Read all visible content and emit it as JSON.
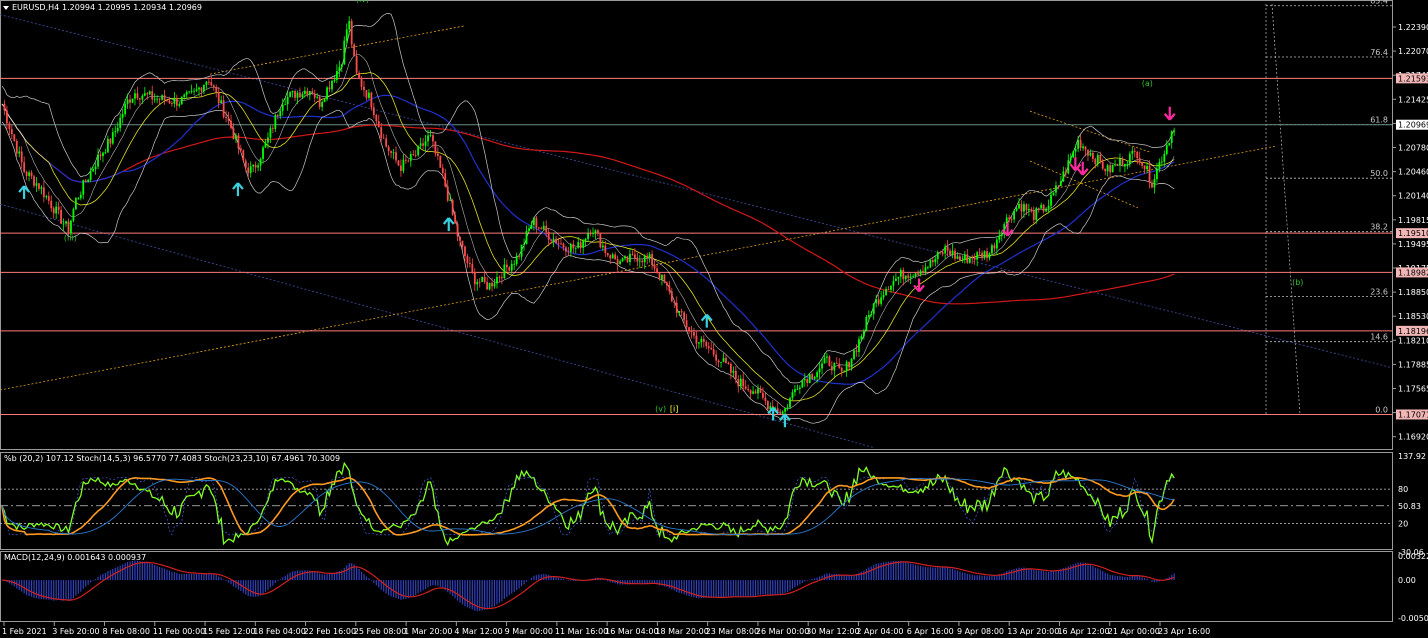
{
  "header": {
    "symbol": "EURUSD,H4",
    "ohlc": "1.20994 1.20995 1.20934 1.20969"
  },
  "colors": {
    "background": "#000000",
    "bull": "#00ff00",
    "bear": "#ff4d4d",
    "resistance": "#ff7b7b",
    "ma_red": "#d01818",
    "ma_blue": "#2030d0",
    "ma_yellow": "#e0e020",
    "bands": "#c8c8c8",
    "trend_orange": "#e0a020",
    "channel_blue": "#4050a0",
    "arrow_up": "#39d0e0",
    "arrow_down": "#ff2aa0",
    "wave_label": "#30c030",
    "stoch_green": "#80ff20",
    "stoch_orange": "#ff9a20",
    "macd_line": "#d02020",
    "macd_hist": "#3040c0",
    "price_box": "#f2b6b6"
  },
  "main_panel": {
    "price_scale": [
      "1.22390",
      "1.22070",
      "1.21745",
      "1.21425",
      "1.21105",
      "1.20780",
      "1.20460",
      "1.20140",
      "1.19815",
      "1.19495",
      "1.19175",
      "1.18850",
      "1.18530",
      "1.18210",
      "1.17885",
      "1.17565",
      "1.17245",
      "1.16920"
    ],
    "level_boxes": [
      {
        "label": "1.21593",
        "value": 1.21593
      },
      {
        "label": "1.20969",
        "value": 1.20969
      },
      {
        "label": "1.19510",
        "value": 1.1951
      },
      {
        "label": "1.18982",
        "value": 1.18982
      },
      {
        "label": "1.18196",
        "value": 1.18196
      },
      {
        "label": "1.17071",
        "value": 1.17071
      }
    ],
    "fib_levels": [
      {
        "label": "85.4",
        "value": 1.2257
      },
      {
        "label": "76.4",
        "value": 1.2188
      },
      {
        "label": "61.8",
        "value": 1.2097
      },
      {
        "label": "50.0",
        "value": 1.2025
      },
      {
        "label": "38.2",
        "value": 1.1953
      },
      {
        "label": "23.6",
        "value": 1.1866
      },
      {
        "label": "14.6",
        "value": 1.1805
      },
      {
        "label": "0.0",
        "value": 1.1707
      }
    ],
    "wave_labels": [
      {
        "text": "(iv)",
        "date": 24.0,
        "price": 1.2262
      },
      {
        "text": "(iii)",
        "date": 4.2,
        "price": 1.1941
      },
      {
        "text": "(v)",
        "date": 44.3,
        "price": 1.1711
      },
      {
        "text": "[i]",
        "date": 45.3,
        "price": 1.1711
      },
      {
        "text": "(a)",
        "date": 77.3,
        "price": 1.2149
      },
      {
        "text": "(b)",
        "date": 87.5,
        "price": 1.1881
      }
    ],
    "arrows_up": [
      {
        "date": 1.5,
        "price": 1.2005
      },
      {
        "date": 16.0,
        "price": 1.2009
      },
      {
        "date": 30.3,
        "price": 1.1962
      },
      {
        "date": 47.8,
        "price": 1.1832
      },
      {
        "date": 52.3,
        "price": 1.1707
      },
      {
        "date": 53.1,
        "price": 1.1698
      }
    ],
    "arrows_down": [
      {
        "date": 23.3,
        "price": 1.2275
      },
      {
        "date": 62.2,
        "price": 1.1882
      },
      {
        "date": 68.2,
        "price": 1.1957
      },
      {
        "date": 72.8,
        "price": 1.2045
      },
      {
        "date": 73.3,
        "price": 1.2039
      },
      {
        "date": 79.2,
        "price": 1.2113
      }
    ]
  },
  "stoch_panel": {
    "label": "%b (20,2) 107.12  Stoch(14,5,3) 96.5770 77.4083  Stoch(23,23,10) 67.4961 70.3009",
    "scale": [
      "137.92",
      "80",
      "50.83",
      "20",
      "-30.06"
    ],
    "levels": [
      80,
      50.83,
      20
    ]
  },
  "macd_panel": {
    "label": "MACD(12,24,9) 0.001643 0.000937",
    "scale": [
      "0.003225",
      "0.00",
      "-0.005063"
    ]
  },
  "time_axis": [
    "1 Feb 2021",
    "3 Feb 20:00",
    "8 Feb 08:00",
    "11 Feb 00:00",
    "15 Feb 12:00",
    "18 Feb 04:00",
    "22 Feb 16:00",
    "25 Feb 08:00",
    "1 Mar 20:00",
    "4 Mar 12:00",
    "9 Mar 00:00",
    "11 Mar 16:00",
    "16 Mar 04:00",
    "18 Mar 20:00",
    "23 Mar 08:00",
    "26 Mar 00:00",
    "30 Mar 12:00",
    "2 Apr 04:00",
    "6 Apr 16:00",
    "9 Apr 08:00",
    "13 Apr 20:00",
    "16 Apr 12:00",
    "21 Apr 00:00",
    "23 Apr 16:00"
  ],
  "chart_data": {
    "type": "line",
    "title": "EURUSD,H4",
    "xlabel": "",
    "ylabel": "",
    "x_unit": "days since 1 Feb 2021",
    "ylim": [
      1.1662,
      1.2262
    ],
    "grid": false,
    "x": [
      0.0,
      1.5,
      2.5,
      3.5,
      4.5,
      5.0,
      6.5,
      7.5,
      8.5,
      9.0,
      10.5,
      12.0,
      13.0,
      14.0,
      15.5,
      16.5,
      17.0,
      18.0,
      19.0,
      20.0,
      21.0,
      21.5,
      23.0,
      23.5,
      24.0,
      25.0,
      26.0,
      27.0,
      28.0,
      29.0,
      30.0,
      31.0,
      32.0,
      33.0,
      34.0,
      35.0,
      36.0,
      37.0,
      38.0,
      39.0,
      40.0,
      41.0,
      42.0,
      43.0,
      44.0,
      45.0,
      46.0,
      47.0,
      48.0,
      49.0,
      50.0,
      51.0,
      52.0,
      53.0,
      54.0,
      55.0,
      56.0,
      57.0,
      58.0,
      59.0,
      60.0,
      61.0,
      62.0,
      63.0,
      64.0,
      65.0,
      66.0,
      67.0,
      68.0,
      69.0,
      70.0,
      71.0,
      72.0,
      73.0,
      74.0,
      75.0,
      76.0,
      77.0,
      78.0,
      79.0,
      79.5
    ],
    "series": [
      {
        "name": "EURUSD,H4",
        "values": [
          1.2125,
          1.2035,
          1.2015,
          1.1985,
          1.1955,
          1.1995,
          1.2052,
          1.208,
          1.2128,
          1.214,
          1.2132,
          1.2128,
          1.2138,
          1.216,
          1.2095,
          1.204,
          1.2035,
          1.2075,
          1.213,
          1.214,
          1.2145,
          1.2125,
          1.218,
          1.224,
          1.2165,
          1.213,
          1.207,
          1.204,
          1.2055,
          1.2082,
          1.202,
          1.194,
          1.189,
          1.188,
          1.19,
          1.192,
          1.1968,
          1.195,
          1.1935,
          1.193,
          1.196,
          1.1925,
          1.191,
          1.192,
          1.1915,
          1.188,
          1.184,
          1.181,
          1.1795,
          1.1775,
          1.175,
          1.174,
          1.172,
          1.171,
          1.175,
          1.1762,
          1.178,
          1.176,
          1.18,
          1.185,
          1.188,
          1.1895,
          1.19,
          1.191,
          1.193,
          1.1915,
          1.192,
          1.1925,
          1.1965,
          1.199,
          1.1975,
          1.199,
          1.203,
          1.2075,
          1.2055,
          1.2035,
          1.2048,
          1.206,
          1.202,
          1.207,
          1.2097
        ]
      }
    ]
  }
}
